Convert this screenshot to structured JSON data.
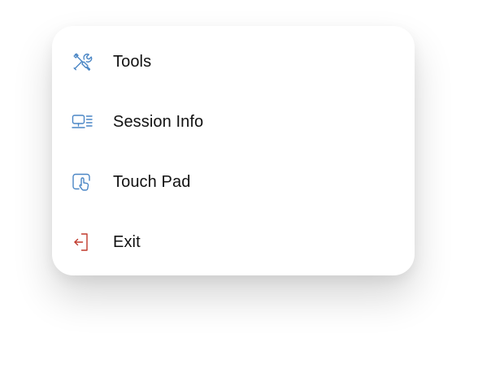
{
  "colors": {
    "icon_blue": "#4a86c5",
    "icon_red": "#c0392b",
    "text": "#111111",
    "background": "#ffffff"
  },
  "menu": {
    "items": [
      {
        "label": "Tools",
        "icon": "wrench-screwdriver-icon"
      },
      {
        "label": "Session Info",
        "icon": "monitor-info-icon"
      },
      {
        "label": "Touch Pad",
        "icon": "touch-pad-icon"
      },
      {
        "label": "Exit",
        "icon": "exit-icon"
      }
    ]
  }
}
